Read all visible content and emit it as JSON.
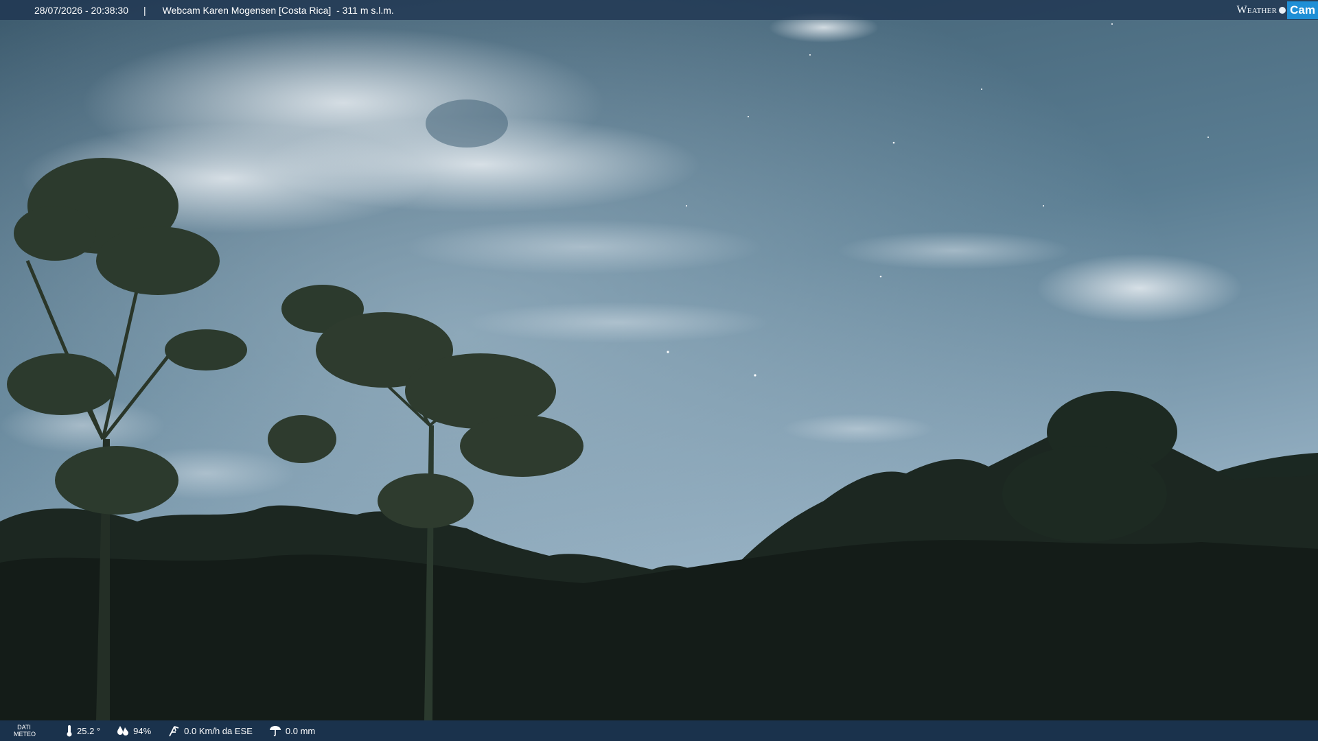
{
  "header": {
    "datetime": "28/07/2026 - 20:38:30",
    "separator": "|",
    "location": "Webcam Karen Mogensen [Costa Rica]  - 311 m s.l.m.",
    "logo_left": "Weather",
    "logo_right": "Cam"
  },
  "footer": {
    "label_line1": "DATI",
    "label_line2": "METEO",
    "temperature": "25.2 °",
    "humidity": "94%",
    "wind": "0.0 Km/h da ESE",
    "rain": "0.0 mm"
  },
  "icons": [
    "thermometer-icon",
    "humidity-icon",
    "wind-icon",
    "rain-icon"
  ],
  "colors": {
    "bar": "#1e3450",
    "logo_accent": "#1f8fd6"
  }
}
